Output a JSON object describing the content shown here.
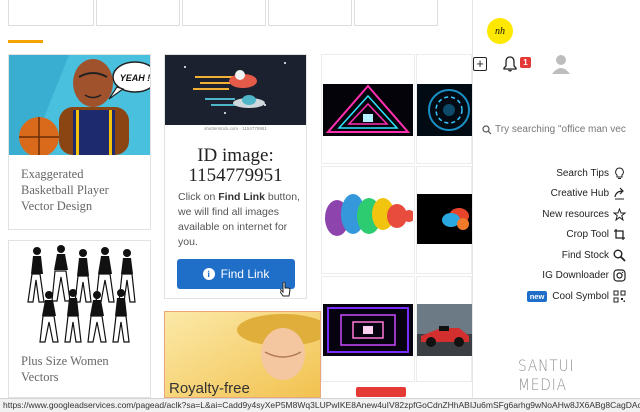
{
  "cards": {
    "basketball": {
      "caption": "Exaggerated Basketball Player Vector Design",
      "speech": "YEAH !"
    },
    "plus_size": {
      "caption": "Plus Size Women Vectors"
    },
    "promo": {
      "id_label": "ID image:",
      "id_value": "1154779951",
      "text_before": "Click on ",
      "text_bold": "Find Link",
      "text_after": " button, we will find all images available on internet for you.",
      "button_label": "Find Link",
      "watermark_small": "shutterstock.com · 1154779951"
    },
    "royalty": {
      "label": "Royalty-free"
    }
  },
  "sidebar": {
    "logo_text": "nh",
    "notification_count": "1",
    "search_placeholder": "Try searching \"office man vec",
    "menu": [
      {
        "label": "Search Tips",
        "icon": "lightbulb-icon"
      },
      {
        "label": "Creative Hub",
        "icon": "share-icon"
      },
      {
        "label": "New resources",
        "icon": "star-icon"
      },
      {
        "label": "Crop Tool",
        "icon": "crop-icon"
      },
      {
        "label": "Find Stock",
        "icon": "magnify-icon"
      },
      {
        "label": "IG Downloader",
        "icon": "instagram-icon"
      },
      {
        "label": "Cool Symbol",
        "icon": "qr-icon",
        "badge": "new"
      }
    ]
  },
  "watermark": "SANTUI MEDIA",
  "status_url": "https://www.googleadservices.com/pagead/aclk?sa=L&ai=Cadd9y4syXeP5M8Wq3LUPwIKE8Anew4uIV82zpfGoCdnZHhABIJu6mSFg6arhg9wNoAHw8JX6ABg8CagDAcgDSqoExwFP0DLRV..."
}
